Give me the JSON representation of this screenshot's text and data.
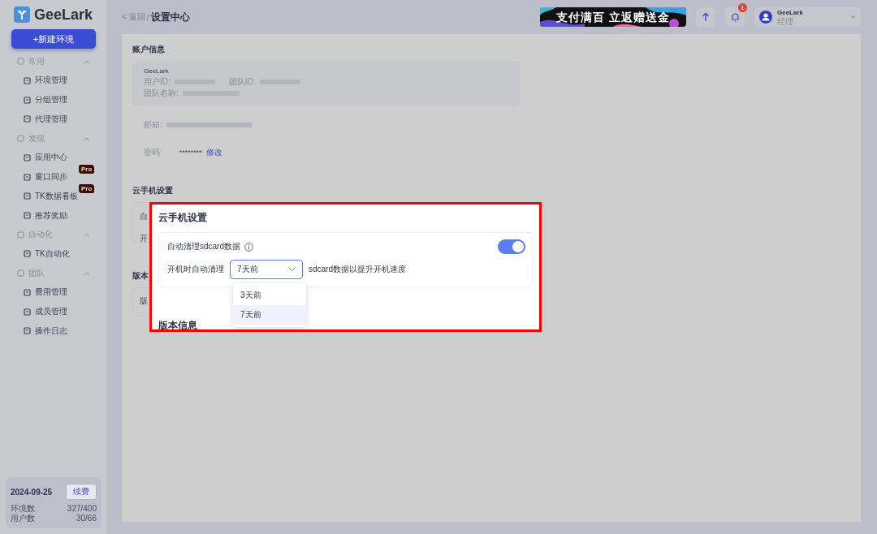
{
  "sidebar": {
    "logo": "GeeLark",
    "new_button": "+新建环境",
    "groups": [
      {
        "label": "常用",
        "expanded": true,
        "items": [
          {
            "label": "环境管理"
          },
          {
            "label": "分组管理"
          },
          {
            "label": "代理管理"
          }
        ]
      },
      {
        "label": "发现",
        "expanded": true,
        "items": [
          {
            "label": "应用中心"
          },
          {
            "label": "窗口同步",
            "badge": "Pro"
          },
          {
            "label": "TK数据看板",
            "badge": "Pro"
          },
          {
            "label": "推荐奖励"
          }
        ]
      },
      {
        "label": "自动化",
        "expanded": true,
        "items": [
          {
            "label": "TK自动化"
          }
        ]
      },
      {
        "label": "团队",
        "expanded": true,
        "items": [
          {
            "label": "费用管理"
          },
          {
            "label": "成员管理"
          },
          {
            "label": "操作日志"
          }
        ]
      }
    ],
    "plan": {
      "date": "2024-09-25",
      "renew": "续费",
      "stats": [
        {
          "label": "环境数",
          "value": "327/400"
        },
        {
          "label": "用户数",
          "value": "30/66"
        }
      ]
    }
  },
  "header": {
    "back": "< 返回",
    "separator": "/",
    "title": "设置中心",
    "banner": "支付满百  立返赠送金",
    "notifications": "1",
    "user": {
      "name": "GeeLark",
      "role": "经理"
    }
  },
  "account": {
    "title": "账户信息",
    "name": "GeeLark",
    "card_fields": [
      {
        "label": "用户ID:"
      },
      {
        "label": "团队ID:"
      },
      {
        "label": "团队名称:"
      }
    ],
    "email_label": "邮箱:",
    "password_label": "密码:",
    "password": "********",
    "change": "修改"
  },
  "cloud_phone": {
    "title": "云手机设置",
    "fragments": [
      "自",
      "开"
    ]
  },
  "version": {
    "title": "版本",
    "fragments": [
      "版"
    ]
  },
  "callout": {
    "title": "云手机设置",
    "setting": {
      "label": "自动清理sdcard数据",
      "on": true
    },
    "prefix": "开机时自动清理",
    "select": {
      "value": "7天前",
      "open": true
    },
    "suffix": "sdcard数据以提升开机速度",
    "options": [
      {
        "label": "3天前",
        "selected": false
      },
      {
        "label": "7天前",
        "selected": true
      }
    ],
    "next_title": "版本信息"
  }
}
